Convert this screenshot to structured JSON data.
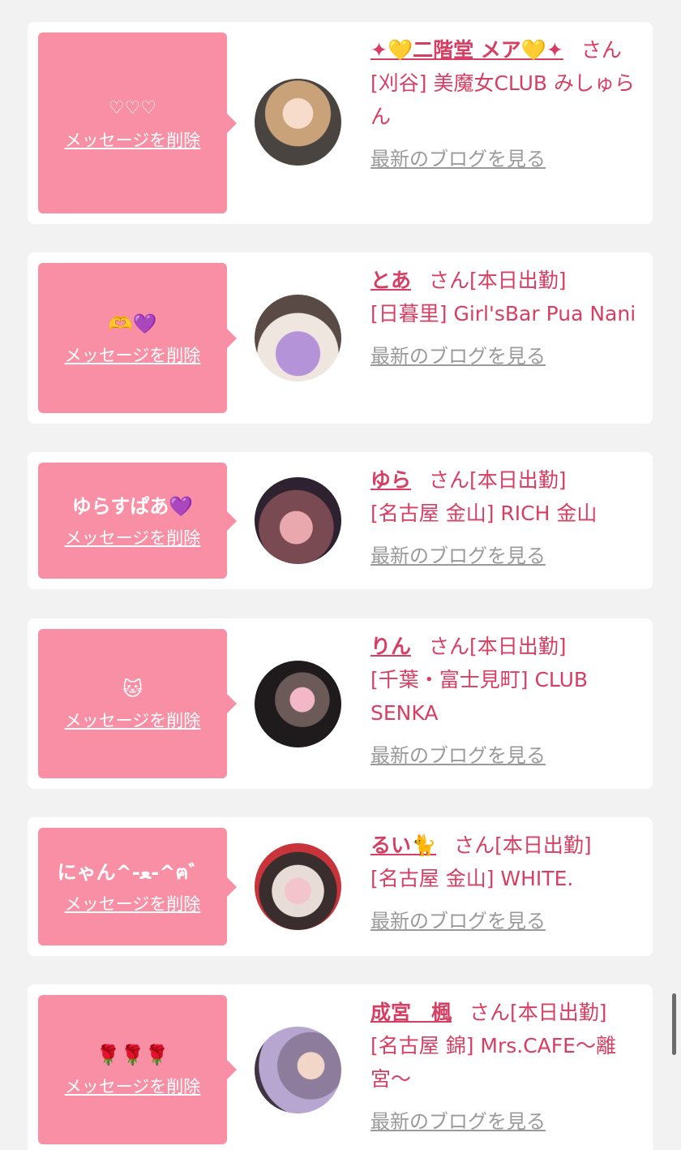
{
  "delete_label": "メッセージを削除",
  "blog_label": "最新のブログを見る",
  "san": "さん",
  "colors": {
    "background": "#f2f2f2",
    "bubble": "#f98fa4",
    "accent_text": "#d63f63",
    "link_grey": "#9a9a9a"
  },
  "entries": [
    {
      "message": "♡♡♡",
      "name": "✦💛二階堂 メア💛✦",
      "status": "",
      "shop": "[刈谷] 美魔女CLUB みしゅらん"
    },
    {
      "message": "🫶💜",
      "name": "とあ",
      "status": "[本日出勤]",
      "shop": "[日暮里] Girl'sBar Pua Nani"
    },
    {
      "message": "ゆらすぱあ💜",
      "name": "ゆら",
      "status": "[本日出勤]",
      "shop": "[名古屋 金山] RICH 金山"
    },
    {
      "message": "🐱",
      "name": "りん",
      "status": "[本日出勤]",
      "shop": "[千葉・富士見町] CLUB SENKA"
    },
    {
      "message": "にゃん^-ﻌ-^ฅ゛",
      "name": "るい🐈",
      "status": "[本日出勤]",
      "shop": "[名古屋 金山] WHITE."
    },
    {
      "message": "🌹🌹🌹",
      "name": "成宮　楓",
      "status": "[本日出勤]",
      "shop": "[名古屋 錦] Mrs.CAFE〜離宮〜"
    }
  ]
}
